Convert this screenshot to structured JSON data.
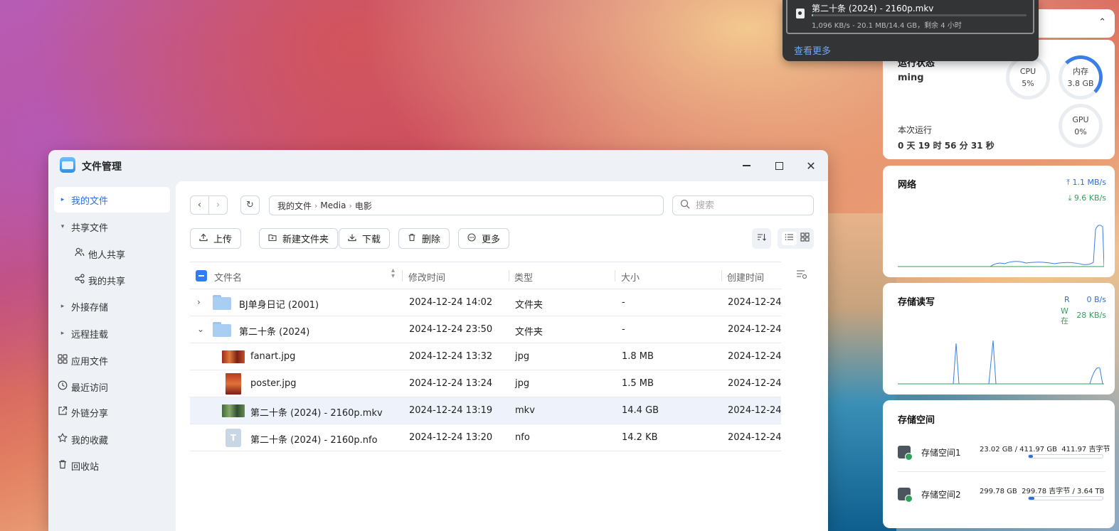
{
  "window": {
    "title": "文件管理",
    "min_glyph": "",
    "max_glyph": "",
    "close_glyph": "✕"
  },
  "sidebar": {
    "items": [
      {
        "label": "我的文件",
        "arrow": "▸",
        "active": true
      },
      {
        "label": "共享文件",
        "arrow": "▾"
      },
      {
        "label": "他人共享",
        "icon": "users-icon"
      },
      {
        "label": "我的共享",
        "icon": "share-icon"
      },
      {
        "label": "外接存储",
        "arrow": "▸"
      },
      {
        "label": "远程挂载",
        "arrow": "▸"
      },
      {
        "label": "应用文件",
        "icon": "apps-icon"
      },
      {
        "label": "最近访问",
        "icon": "clock-icon"
      },
      {
        "label": "外链分享",
        "icon": "external-link-icon"
      },
      {
        "label": "我的收藏",
        "icon": "star-icon"
      },
      {
        "label": "回收站",
        "icon": "trash-icon"
      }
    ]
  },
  "nav": {
    "back": "‹",
    "forward": "›",
    "refresh": "↻"
  },
  "breadcrumb": [
    "我的文件",
    "Media",
    "电影"
  ],
  "breadcrumb_sep": "›",
  "search": {
    "placeholder": "搜索",
    "value": ""
  },
  "toolbar": {
    "upload": "上传",
    "new_folder": "新建文件夹",
    "download": "下载",
    "delete": "删除",
    "more": "更多"
  },
  "table": {
    "headers": {
      "name": "文件名",
      "modified": "修改时间",
      "type": "类型",
      "size": "大小",
      "created": "创建时间"
    },
    "rows": [
      {
        "name": "BJ单身日记 (2001)",
        "modified": "2024-12-24 14:02",
        "type": "文件夹",
        "size": "-",
        "created": "2024-12-24",
        "kind": "folder",
        "expand": "›"
      },
      {
        "name": "第二十条 (2024)",
        "modified": "2024-12-24 23:50",
        "type": "文件夹",
        "size": "-",
        "created": "2024-12-24",
        "kind": "folder",
        "expand": "⌄"
      },
      {
        "name": "fanart.jpg",
        "modified": "2024-12-24 13:32",
        "type": "jpg",
        "size": "1.8 MB",
        "created": "2024-12-24",
        "kind": "image"
      },
      {
        "name": "poster.jpg",
        "modified": "2024-12-24 13:24",
        "type": "jpg",
        "size": "1.5 MB",
        "created": "2024-12-24",
        "kind": "image"
      },
      {
        "name": "第二十条 (2024) - 2160p.mkv",
        "modified": "2024-12-24 13:19",
        "type": "mkv",
        "size": "14.4 GB",
        "created": "2024-12-24",
        "kind": "video",
        "selected": true
      },
      {
        "name": "第二十条 (2024) - 2160p.nfo",
        "modified": "2024-12-24 13:20",
        "type": "nfo",
        "size": "14.2 KB",
        "created": "2024-12-24",
        "kind": "text",
        "glyph": "T"
      }
    ]
  },
  "widgets": {
    "status": {
      "title": "运行状态",
      "user": "ming",
      "uptime_label": "本次运行",
      "uptime_value": "0 天 19 时 56 分 31 秒",
      "cpu_label": "CPU",
      "cpu_value": "5%",
      "mem_label": "内存",
      "mem_value": "3.8 GB",
      "gpu_label": "GPU",
      "gpu_value": "0%",
      "cpu_fraction": 0.05,
      "gpu_fraction": 0.0
    },
    "network": {
      "title": "网络",
      "up": "1.1 MB/s",
      "down": "9.6 KB/s"
    },
    "io": {
      "title": "存储读写",
      "read_label": "R",
      "read_value": "0 B/s",
      "write_label": "W\n在",
      "write_value": "28 KB/s"
    },
    "storage": {
      "title": "存储空间",
      "pools": [
        {
          "name": "存储空间1",
          "used": "23.02 GB",
          "total": "411.97 GB",
          "extra": "411.97 吉字节",
          "fraction": 0.056
        },
        {
          "name": "存储空间2",
          "used": "299.78 GB",
          "total": "3.64 TB",
          "extra": "299.78 吉字节",
          "fraction": 0.08
        }
      ]
    },
    "collapse_glyph": "⌃"
  },
  "download_popup": {
    "file": "第二十条 (2024) - 2160p.mkv",
    "meta": "1,096 KB/s - 20.1 MB/14.4 GB，剩余 4 小时",
    "progress": 0.0014,
    "more": "查看更多"
  },
  "colors": {
    "accent": "#2f6fd6",
    "success": "#2ea25a",
    "selected_row": "#eef3fb"
  }
}
